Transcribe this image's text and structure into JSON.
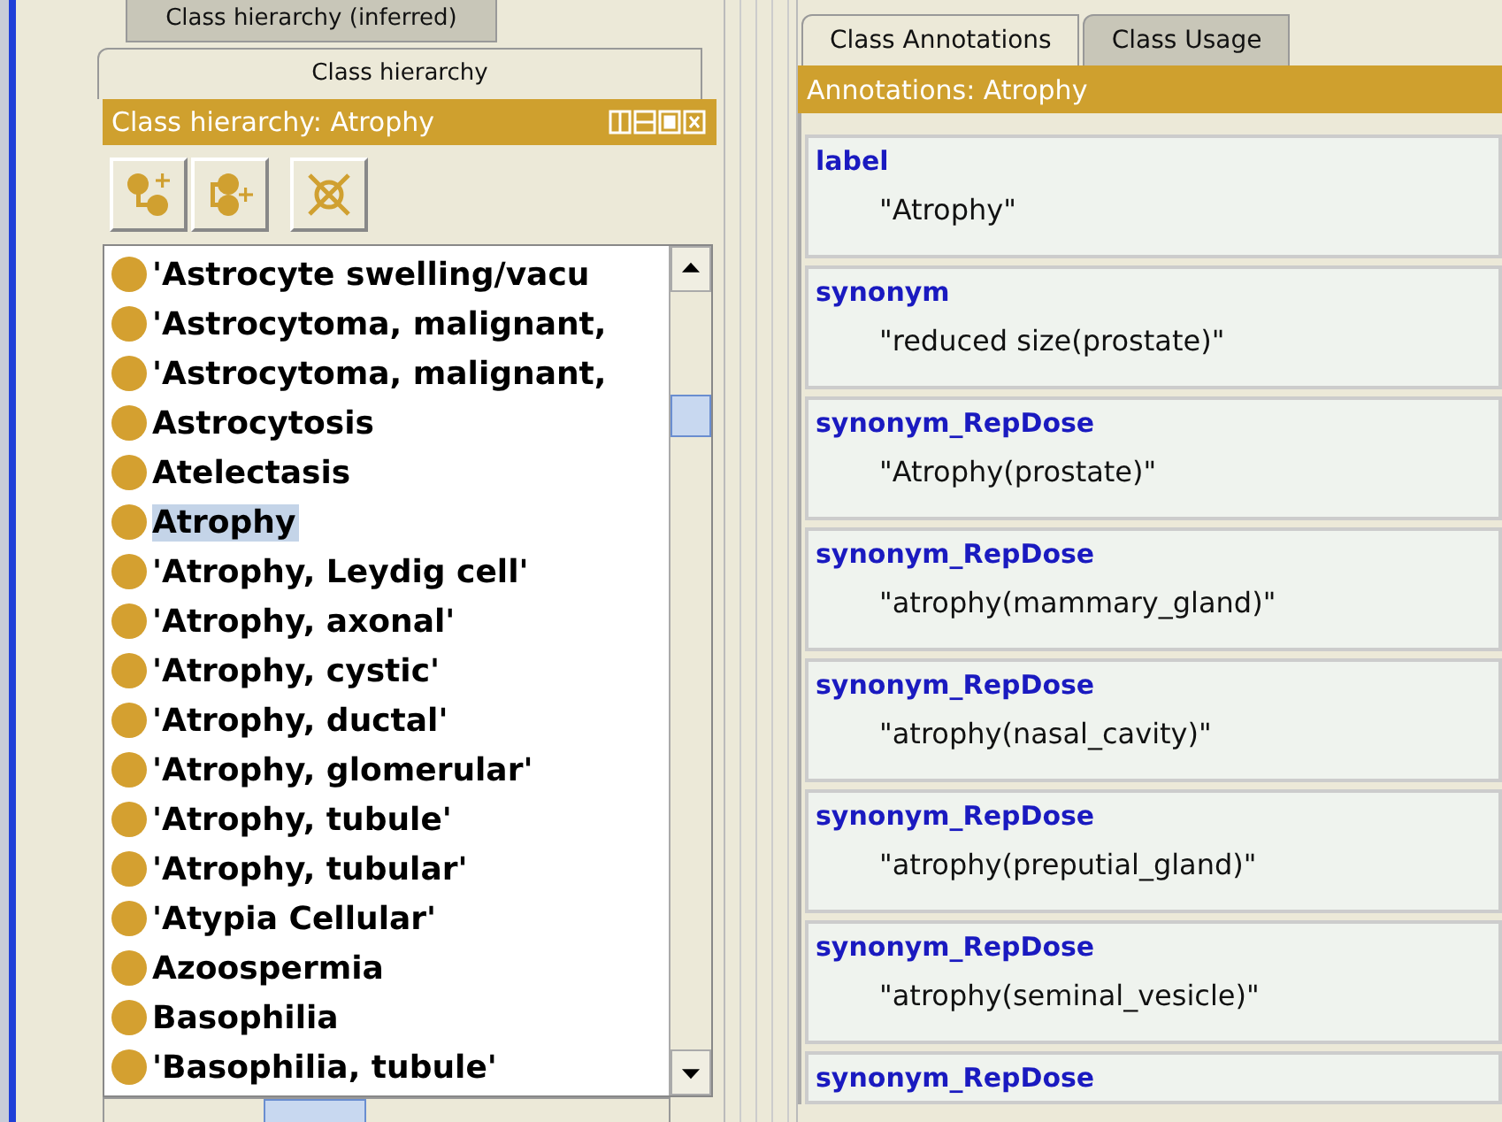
{
  "left_panel": {
    "tabs": [
      {
        "label": "Class hierarchy (inferred)",
        "selected": false
      },
      {
        "label": "Class hierarchy",
        "selected": true
      }
    ],
    "header": {
      "title": "Class hierarchy: Atrophy"
    },
    "tree": [
      {
        "label": "'Astrocyte swelling/vacu",
        "selected": false
      },
      {
        "label": "'Astrocytoma, malignant,",
        "selected": false
      },
      {
        "label": "'Astrocytoma, malignant,",
        "selected": false
      },
      {
        "label": "Astrocytosis",
        "selected": false
      },
      {
        "label": "Atelectasis",
        "selected": false
      },
      {
        "label": "Atrophy",
        "selected": true
      },
      {
        "label": "'Atrophy, Leydig cell'",
        "selected": false
      },
      {
        "label": "'Atrophy, axonal'",
        "selected": false
      },
      {
        "label": "'Atrophy, cystic'",
        "selected": false
      },
      {
        "label": "'Atrophy, ductal'",
        "selected": false
      },
      {
        "label": "'Atrophy, glomerular'",
        "selected": false
      },
      {
        "label": "'Atrophy, tubule'",
        "selected": false
      },
      {
        "label": "'Atrophy, tubular'",
        "selected": false
      },
      {
        "label": "'Atypia Cellular'",
        "selected": false
      },
      {
        "label": "Azoospermia",
        "selected": false
      },
      {
        "label": "Basophilia",
        "selected": false
      },
      {
        "label": "'Basophilia, tubule'",
        "selected": false
      }
    ]
  },
  "right_panel": {
    "tabs": [
      {
        "label": "Class Annotations",
        "selected": true
      },
      {
        "label": "Class Usage",
        "selected": false
      }
    ],
    "header": {
      "title": "Annotations: Atrophy"
    },
    "annotations": [
      {
        "property": "label",
        "value": "\"Atrophy\""
      },
      {
        "property": "synonym",
        "value": "\"reduced size(prostate)\""
      },
      {
        "property": "synonym_RepDose",
        "value": "\"Atrophy(prostate)\""
      },
      {
        "property": "synonym_RepDose",
        "value": "\"atrophy(mammary_gland)\""
      },
      {
        "property": "synonym_RepDose",
        "value": "\"atrophy(nasal_cavity)\""
      },
      {
        "property": "synonym_RepDose",
        "value": "\"atrophy(preputial_gland)\""
      },
      {
        "property": "synonym_RepDose",
        "value": "\"atrophy(seminal_vesicle)\""
      },
      {
        "property": "synonym_RepDose"
      }
    ]
  }
}
